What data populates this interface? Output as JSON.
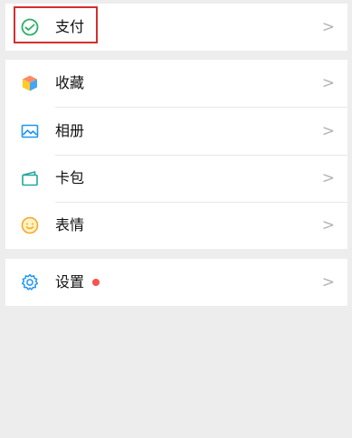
{
  "colors": {
    "background": "#ededed",
    "row_background": "#ffffff",
    "highlight_border": "#d32f2f",
    "pay_icon": "#2aae67",
    "badge_dot": "#fa5151"
  },
  "menu": {
    "pay": {
      "label": "支付",
      "icon": "wechat-pay-icon",
      "highlighted": true
    },
    "group2": [
      {
        "label": "收藏",
        "icon": "cube-favorites-icon"
      },
      {
        "label": "相册",
        "icon": "photo-album-icon"
      },
      {
        "label": "卡包",
        "icon": "card-wallet-icon"
      },
      {
        "label": "表情",
        "icon": "smiley-sticker-icon"
      }
    ],
    "settings": {
      "label": "设置",
      "icon": "gear-icon",
      "has_badge": true
    }
  },
  "chevron": ">"
}
